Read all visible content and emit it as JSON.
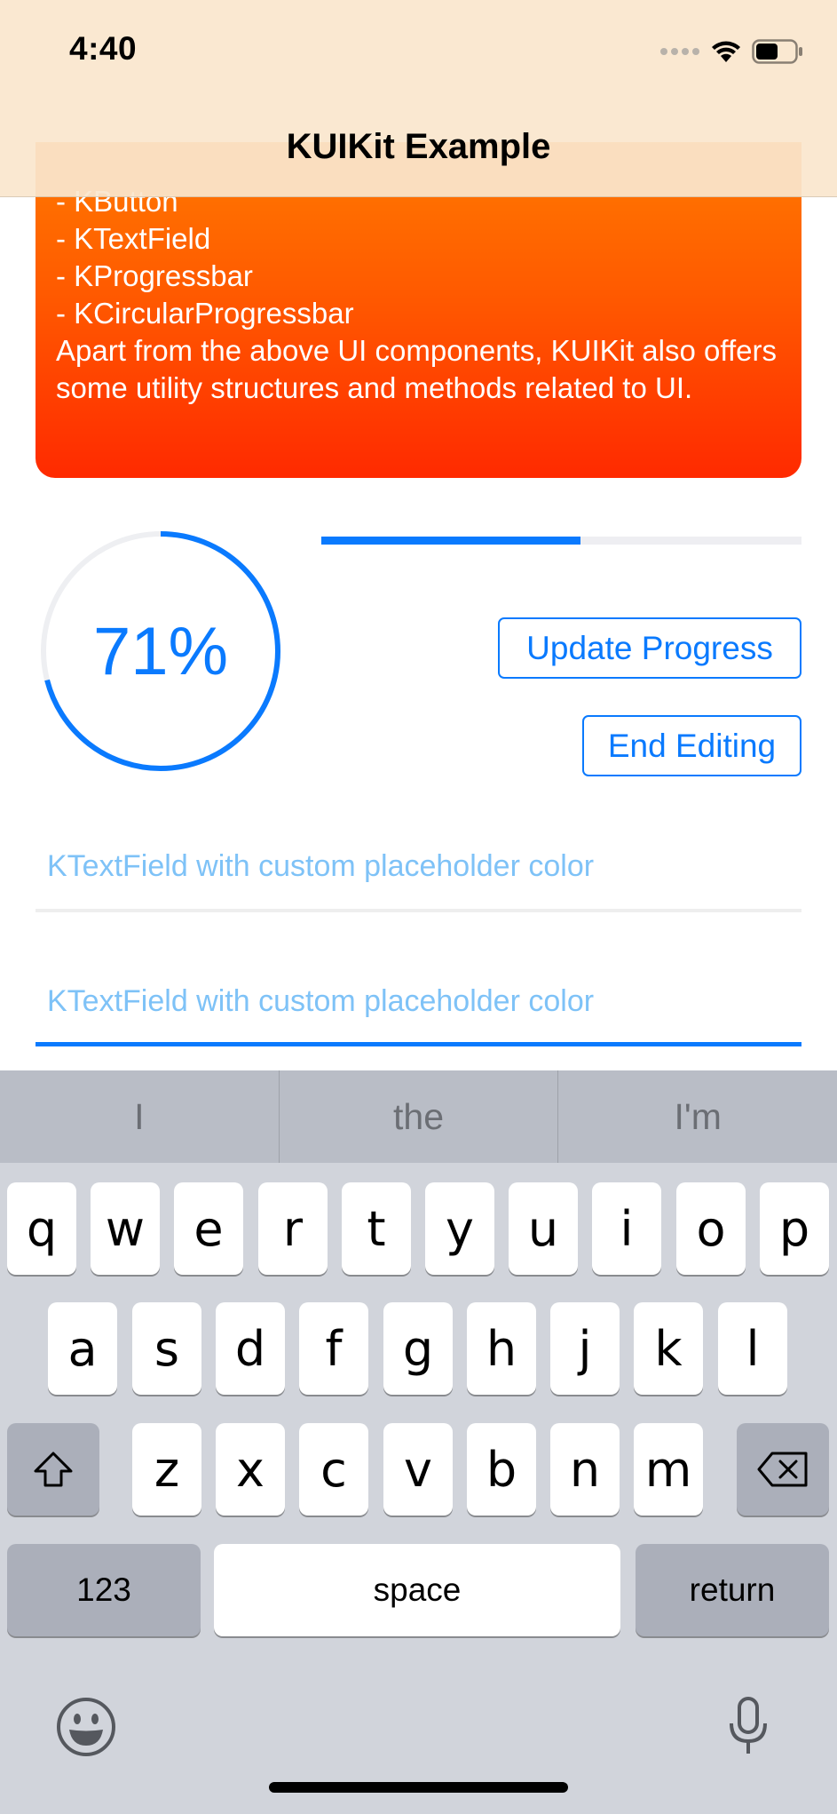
{
  "status_bar": {
    "time": "4:40"
  },
  "nav": {
    "title": "KUIKit Example"
  },
  "info_card": {
    "lines": [
      "- KButton",
      "- KTextField",
      "- KProgressbar",
      "- KCircularProgressbar"
    ],
    "paragraph": "Apart from the above UI components, KUIKit also offers some utility structures and methods related to UI."
  },
  "circular_progress": {
    "label": "71%",
    "value": 0.71
  },
  "linear_progress": {
    "value": 0.54
  },
  "buttons": {
    "update": "Update Progress",
    "end": "End Editing"
  },
  "text_fields": [
    {
      "placeholder": "KTextField with custom placeholder color",
      "value": ""
    },
    {
      "placeholder": "KTextField with custom placeholder color",
      "value": ""
    }
  ],
  "keyboard": {
    "suggestions": [
      "I",
      "the",
      "I'm"
    ],
    "row1": [
      "q",
      "w",
      "e",
      "r",
      "t",
      "y",
      "u",
      "i",
      "o",
      "p"
    ],
    "row2": [
      "a",
      "s",
      "d",
      "f",
      "g",
      "h",
      "j",
      "k",
      "l"
    ],
    "row3": [
      "z",
      "x",
      "c",
      "v",
      "b",
      "n",
      "m"
    ],
    "numbers_key": "123",
    "space_key": "space",
    "return_key": "return"
  },
  "colors": {
    "accent": "#0a7afe",
    "placeholder": "#7ec2f7",
    "card_top": "#ff7a00",
    "card_bottom": "#ff2a00",
    "nav_background": "#fae6cd"
  },
  "icons": {
    "shift": "shift-icon",
    "delete": "delete-icon",
    "emoji": "emoji-icon",
    "mic": "microphone-icon",
    "wifi": "wifi-icon",
    "battery": "battery-icon",
    "signal": "signal-icon"
  }
}
